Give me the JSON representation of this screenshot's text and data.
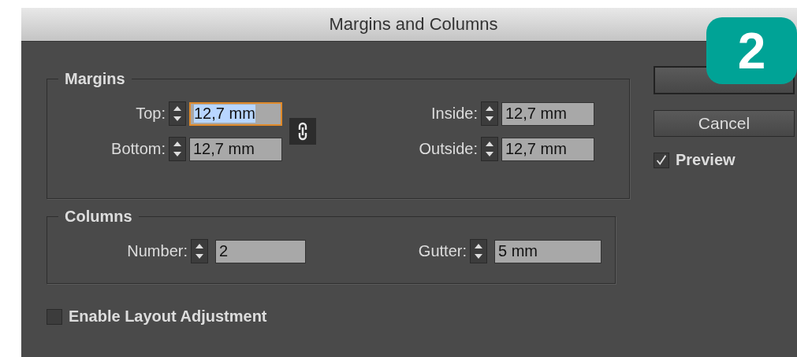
{
  "window": {
    "title": "Margins and Columns"
  },
  "margins": {
    "legend": "Margins",
    "fields": [
      {
        "label": "Top:",
        "value": "12,7 mm",
        "focused": true
      },
      {
        "label": "Inside:",
        "value": "12,7 mm",
        "focused": false
      },
      {
        "label": "Bottom:",
        "value": "12,7 mm",
        "focused": false
      },
      {
        "label": "Outside:",
        "value": "12,7 mm",
        "focused": false
      }
    ],
    "linked": true
  },
  "columns": {
    "legend": "Columns",
    "fields": [
      {
        "label": "Number:",
        "value": "2",
        "focused": false
      },
      {
        "label": "Gutter:",
        "value": "5 mm",
        "focused": false
      }
    ]
  },
  "enable_layout_adjustment": {
    "label": "Enable Layout Adjustment",
    "checked": false
  },
  "buttons": [
    {
      "kind": "default"
    },
    {
      "kind": "normal",
      "label": "Cancel"
    }
  ],
  "preview": {
    "label": "Preview",
    "checked": true
  },
  "step_badge": "2"
}
